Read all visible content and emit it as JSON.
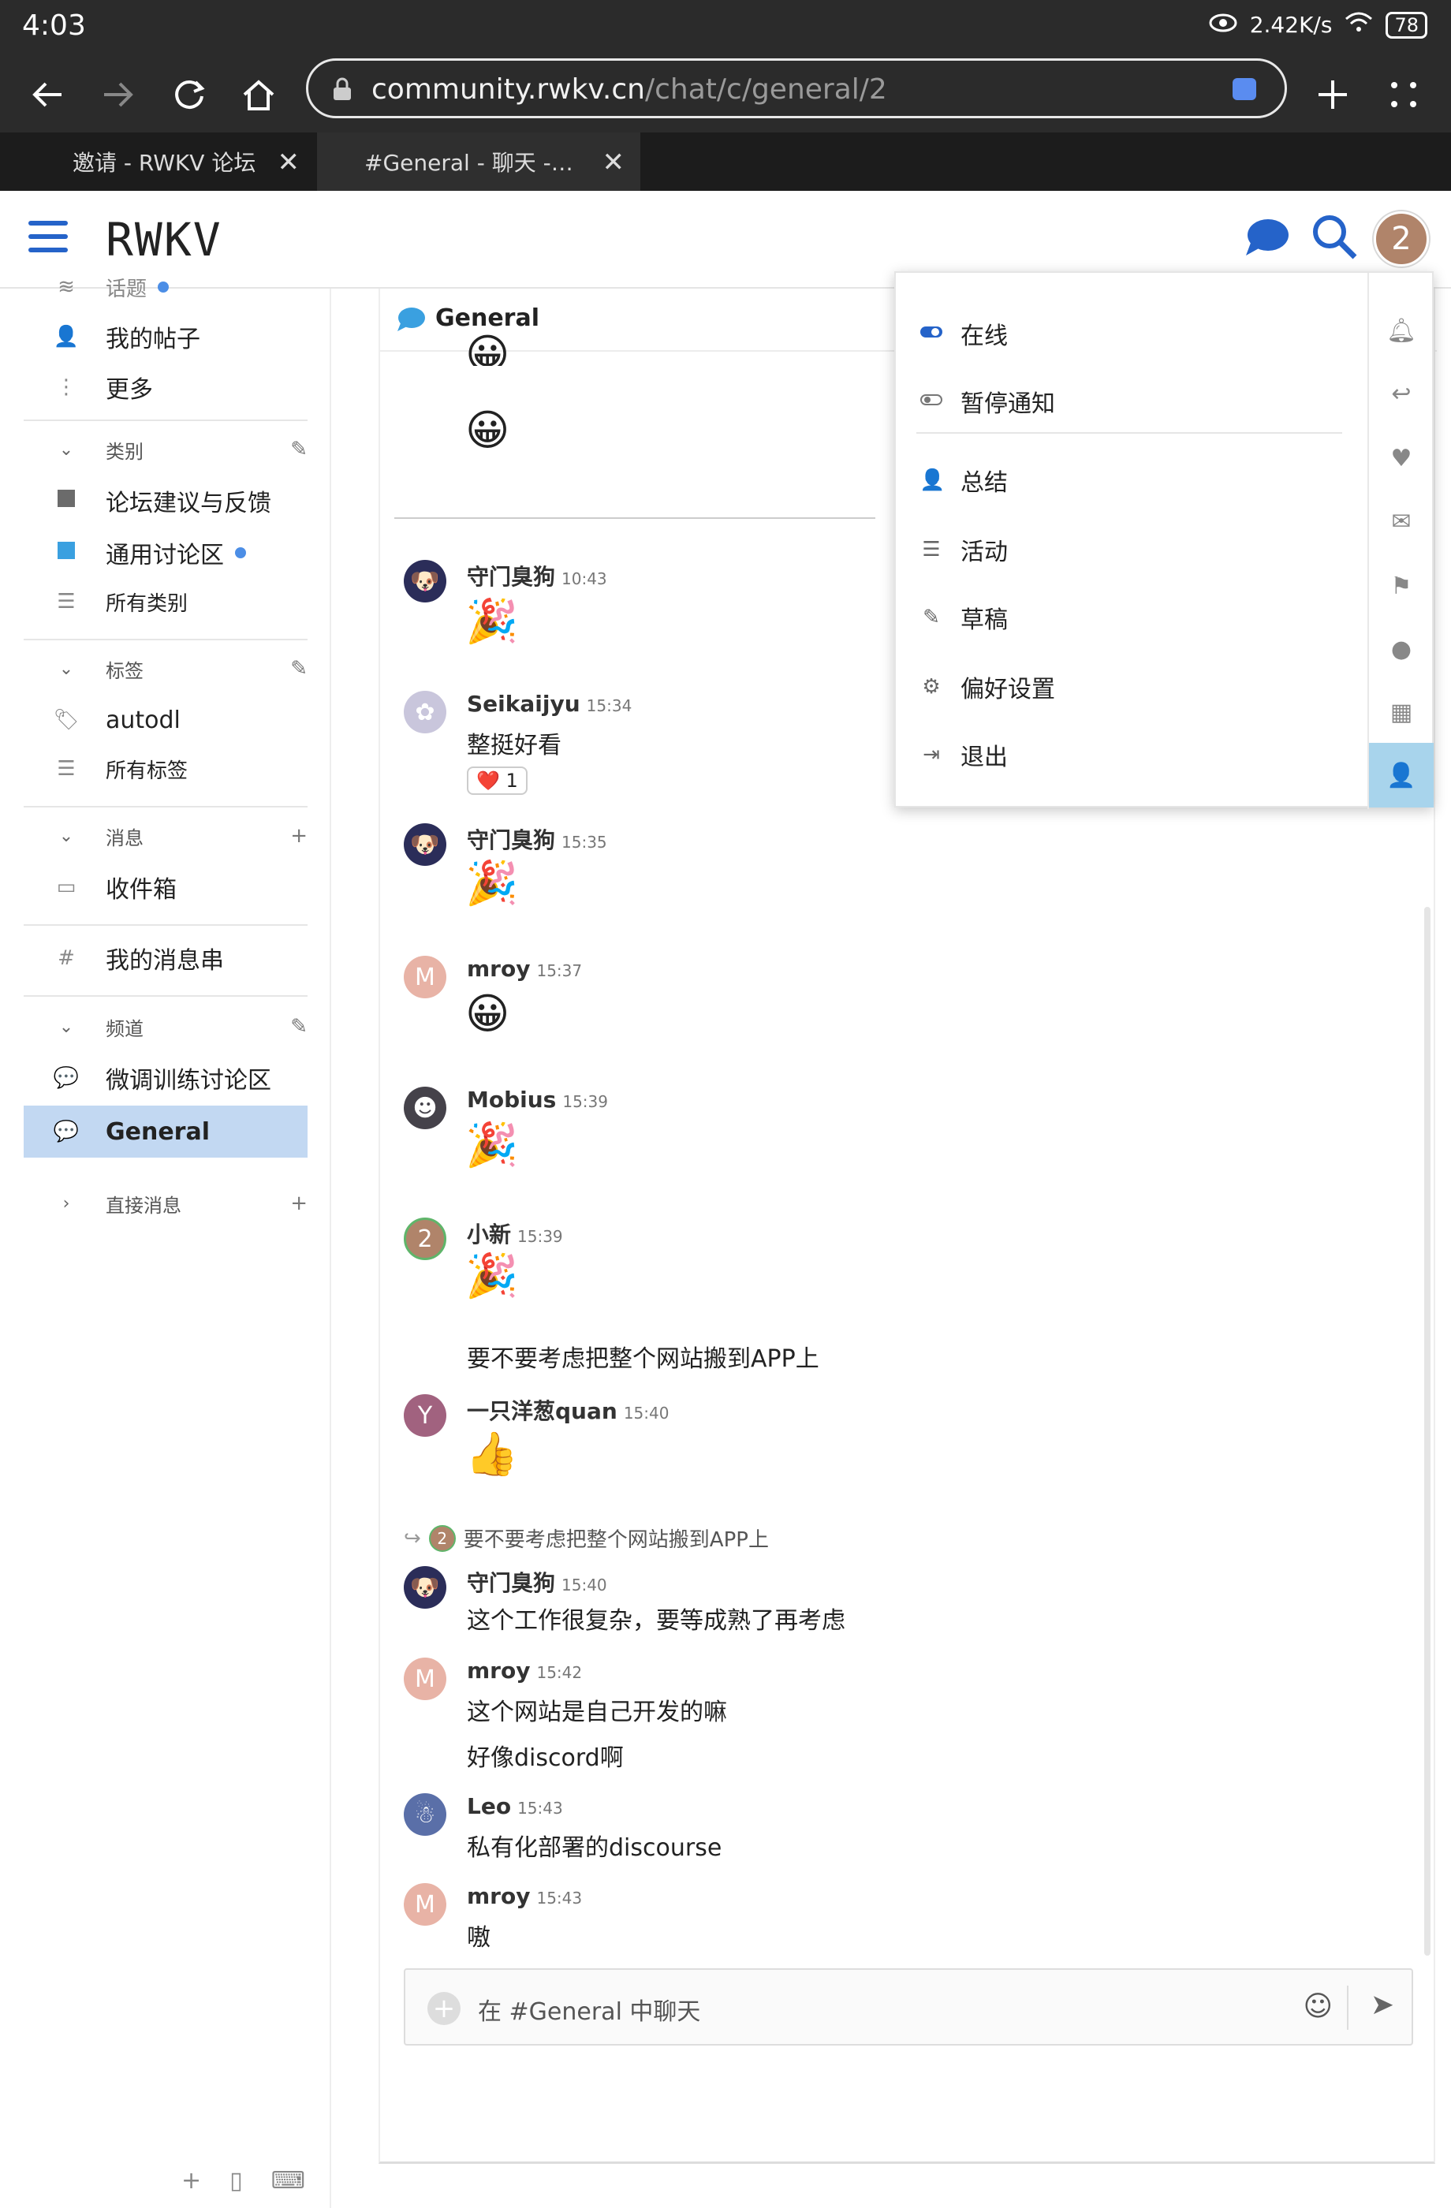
{
  "status_bar": {
    "time": "4:03",
    "net_speed": "2.42K/s",
    "battery": "78"
  },
  "browser": {
    "url_host": "community.rwkv.cn",
    "url_path": "/chat/c/general/2",
    "tabs": [
      {
        "label": "邀请 - RWKV 论坛"
      },
      {
        "label": "#General - 聊天 -…"
      }
    ]
  },
  "header": {
    "brand": "RWKV",
    "avatar_letter": "2"
  },
  "sidebar": {
    "cut_top": "话题",
    "my_posts": "我的帖子",
    "more": "更多",
    "categories_heading": "类别",
    "categories": [
      {
        "label": "论坛建议与反馈",
        "color": "#6b6b6b"
      },
      {
        "label": "通用讨论区",
        "color": "#3aa0e0"
      },
      {
        "label": "所有类别"
      }
    ],
    "tags_heading": "标签",
    "tags": [
      {
        "label": "autodl"
      },
      {
        "label": "所有标签"
      }
    ],
    "messages_heading": "消息",
    "inbox": "收件箱",
    "my_threads": "我的消息串",
    "channels_heading": "频道",
    "channels": [
      {
        "label": "微调训练讨论区"
      },
      {
        "label": "General"
      }
    ],
    "dm_heading": "直接消息"
  },
  "chat": {
    "channel_title": "General",
    "messages": [
      {
        "author": "守门臭狗",
        "time": "10:43",
        "emoji": "🎉"
      },
      {
        "author": "Seikaijyu",
        "time": "15:34",
        "text": "整挺好看",
        "reaction_emoji": "❤️",
        "reaction_count": "1"
      },
      {
        "author": "守门臭狗",
        "time": "15:35",
        "emoji": "🎉"
      },
      {
        "author": "mroy",
        "time": "15:37",
        "emoji": "😀",
        "avatar_letter": "M"
      },
      {
        "author": "Mobius",
        "time": "15:39",
        "emoji": "🎉"
      },
      {
        "author": "小新",
        "time": "15:39",
        "emoji": "🎉",
        "text": "要不要考虑把整个网站搬到APP上",
        "avatar_letter": "2"
      },
      {
        "author": "一只洋葱quan",
        "time": "15:40",
        "emoji": "👍",
        "avatar_letter": "Y"
      },
      {
        "reply_to": "要不要考虑把整个网站搬到APP上",
        "reply_avatar": "2"
      },
      {
        "author": "守门臭狗",
        "time": "15:40",
        "text": "这个工作很复杂，要等成熟了再考虑"
      },
      {
        "author": "mroy",
        "time": "15:42",
        "text": "这个网站是自己开发的嘛",
        "text2": "好像discord啊",
        "avatar_letter": "M"
      },
      {
        "author": "Leo",
        "time": "15:43",
        "text": "私有化部署的discourse"
      },
      {
        "author": "mroy",
        "time": "15:43",
        "text": "嗷",
        "avatar_letter": "M"
      }
    ],
    "composer_placeholder": "在 #General 中聊天"
  },
  "user_menu": {
    "items": [
      {
        "label": "在线"
      },
      {
        "label": "暂停通知"
      },
      {
        "label": "总结"
      },
      {
        "label": "活动"
      },
      {
        "label": "草稿"
      },
      {
        "label": "偏好设置"
      },
      {
        "label": "退出"
      }
    ]
  }
}
